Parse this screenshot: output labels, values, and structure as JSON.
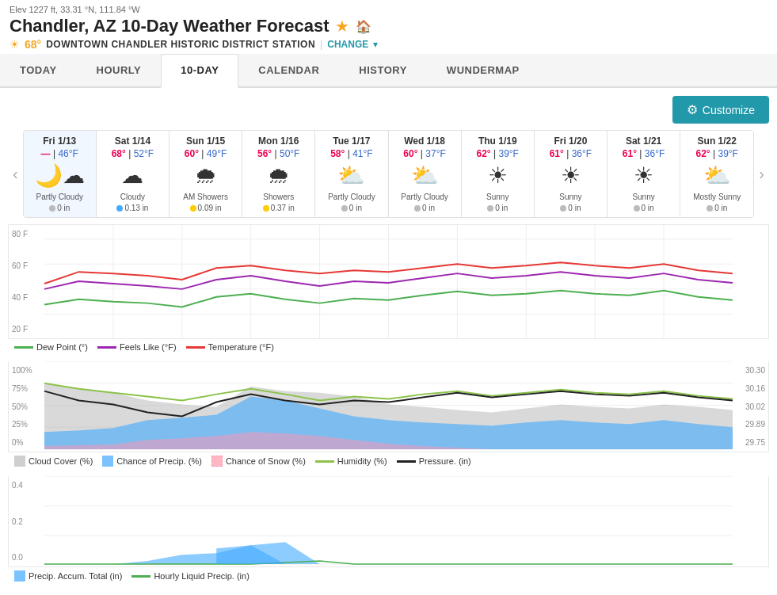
{
  "meta": {
    "elev": "Elev 1227 ft, 33.31 °N, 111.84 °W",
    "title": "Chandler, AZ 10-Day Weather Forecast",
    "star": "★",
    "temp_badge": "68°",
    "station": "DOWNTOWN CHANDLER HISTORIC DISTRICT STATION",
    "change_label": "CHANGE"
  },
  "nav": {
    "tabs": [
      "TODAY",
      "HOURLY",
      "10-DAY",
      "CALENDAR",
      "HISTORY",
      "WUNDERMAP"
    ],
    "active": "10-DAY"
  },
  "toolbar": {
    "customize_label": "Customize"
  },
  "days": [
    {
      "label": "Fri 1/13",
      "hi": "—",
      "lo": "46°F",
      "icon": "🌙☁",
      "desc": "Partly Cloudy",
      "precip": "0 in",
      "precip_type": "gray"
    },
    {
      "label": "Sat 1/14",
      "hi": "68°",
      "lo": "52°F",
      "icon": "☁",
      "desc": "Cloudy",
      "precip": "0.13 in",
      "precip_type": "blue"
    },
    {
      "label": "Sun 1/15",
      "hi": "60°",
      "lo": "49°F",
      "icon": "🌧",
      "desc": "AM Showers",
      "precip": "0.09 in",
      "precip_type": "yellow"
    },
    {
      "label": "Mon 1/16",
      "hi": "56°",
      "lo": "50°F",
      "icon": "🌧",
      "desc": "Showers",
      "precip": "0.37 in",
      "precip_type": "yellow"
    },
    {
      "label": "Tue 1/17",
      "hi": "58°",
      "lo": "41°F",
      "icon": "⛅",
      "desc": "Partly Cloudy",
      "precip": "0 in",
      "precip_type": "gray"
    },
    {
      "label": "Wed 1/18",
      "hi": "60°",
      "lo": "37°F",
      "icon": "⛅",
      "desc": "Partly Cloudy",
      "precip": "0 in",
      "precip_type": "gray"
    },
    {
      "label": "Thu 1/19",
      "hi": "62°",
      "lo": "39°F",
      "icon": "☀",
      "desc": "Sunny",
      "precip": "0 in",
      "precip_type": "gray"
    },
    {
      "label": "Fri 1/20",
      "hi": "61°",
      "lo": "36°F",
      "icon": "☀",
      "desc": "Sunny",
      "precip": "0 in",
      "precip_type": "gray"
    },
    {
      "label": "Sat 1/21",
      "hi": "61°",
      "lo": "36°F",
      "icon": "☀",
      "desc": "Sunny",
      "precip": "0 in",
      "precip_type": "gray"
    },
    {
      "label": "Sun 1/22",
      "hi": "62°",
      "lo": "39°F",
      "icon": "⛅",
      "desc": "Mostly Sunny",
      "precip": "0 in",
      "precip_type": "gray"
    }
  ],
  "chart_temp": {
    "y_labels": [
      "80 F",
      "60 F",
      "40 F",
      "20 F"
    ],
    "legend": [
      {
        "label": "Dew Point (°)",
        "color": "#4caf50",
        "type": "line"
      },
      {
        "label": "Feels Like (°F)",
        "color": "#9c27b0",
        "type": "line"
      },
      {
        "label": "Temperature (°F)",
        "color": "#e53935",
        "type": "line"
      }
    ]
  },
  "chart_pct": {
    "y_labels": [
      "100%",
      "75%",
      "50%",
      "25%",
      "0%"
    ],
    "y_right": [
      "30.30",
      "30.16",
      "30.02",
      "29.89",
      "29.75"
    ],
    "legend": [
      {
        "label": "Cloud Cover (%)",
        "color": "#bbb",
        "type": "area"
      },
      {
        "label": "Chance of Precip. (%)",
        "color": "#4af",
        "type": "area"
      },
      {
        "label": "Chance of Snow (%)",
        "color": "#f9a",
        "type": "area"
      },
      {
        "label": "Humidity (%)",
        "color": "#8bc34a",
        "type": "line"
      },
      {
        "label": "Pressure. (in)",
        "color": "#222",
        "type": "line"
      }
    ]
  },
  "chart_precip": {
    "y_labels": [
      "0.4",
      "0.2",
      "0.0"
    ],
    "legend": [
      {
        "label": "Precip. Accum. Total (in)",
        "color": "#4af",
        "type": "area"
      },
      {
        "label": "Hourly Liquid Precip. (in)",
        "color": "#4caf50",
        "type": "line"
      }
    ]
  }
}
